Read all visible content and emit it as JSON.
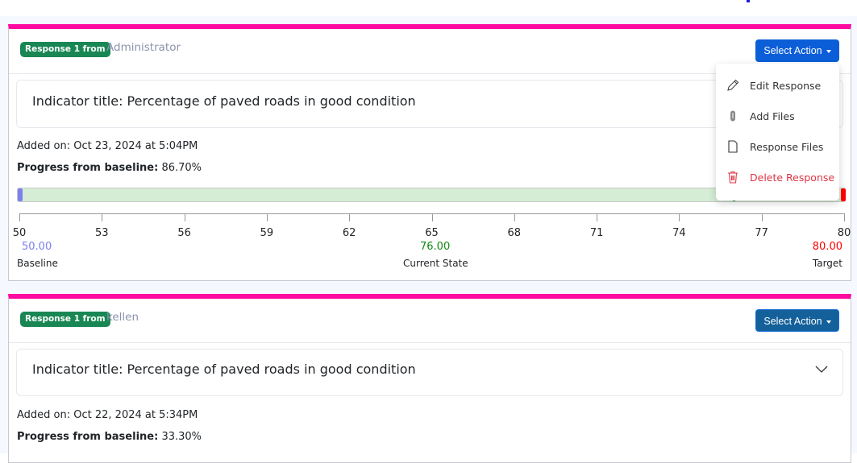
{
  "responses": [
    {
      "badge": "Response 1 from",
      "author": "Administrator",
      "action_button": "Select Action",
      "indicator_title": "Indicator title: Percentage of paved roads in good condition",
      "added_on": "Added on: Oct 23, 2024 at 5:04PM",
      "progress_label": "Progress from baseline:",
      "progress_value": "86.70%",
      "scale": {
        "min": 50,
        "max": 80,
        "ticks": [
          "50",
          "53",
          "56",
          "59",
          "62",
          "65",
          "68",
          "71",
          "74",
          "77",
          "80"
        ],
        "baseline_value": "50.00",
        "current_value": "76.00",
        "target_value": "80.00",
        "baseline_label": "Baseline",
        "current_label": "Current State",
        "target_label": "Target",
        "current": 76
      },
      "colors": {
        "baseline": "#7b7ff0",
        "current": "#138a13",
        "target": "#ff0000"
      }
    },
    {
      "badge": "Response 1 from",
      "author": "kellen",
      "action_button": "Select Action",
      "indicator_title": "Indicator title: Percentage of paved roads in good condition",
      "added_on": "Added on: Oct 22, 2024 at 5:34PM",
      "progress_label": "Progress from baseline:",
      "progress_value": "33.30%"
    }
  ],
  "menu": {
    "items": [
      {
        "label": "Edit Response",
        "icon": "pencil-icon"
      },
      {
        "label": "Add Files",
        "icon": "paperclip-icon"
      },
      {
        "label": "Response Files",
        "icon": "file-icon"
      },
      {
        "label": "Delete Response",
        "icon": "trash-icon"
      }
    ]
  }
}
